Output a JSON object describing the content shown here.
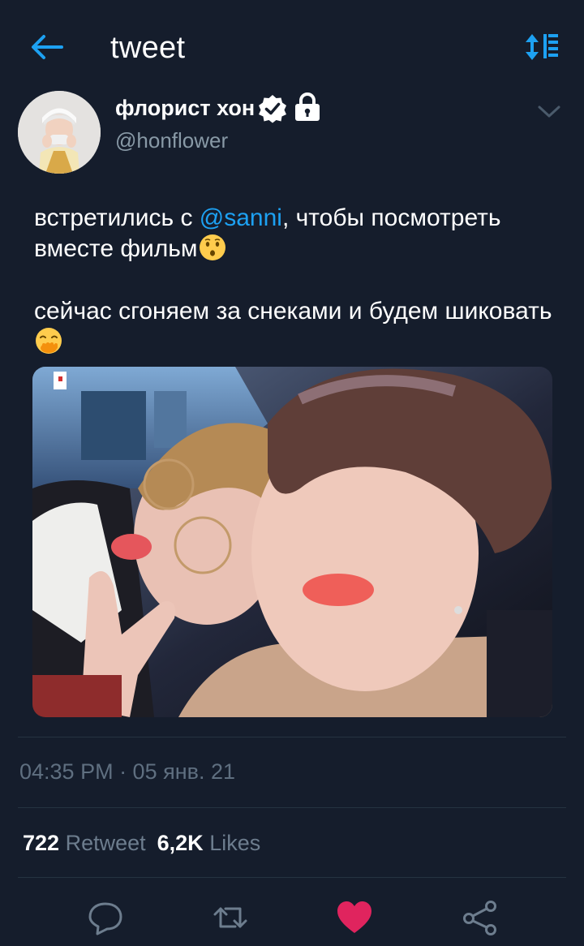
{
  "header": {
    "back_icon": "arrow-left-icon",
    "title": "tweet",
    "sort_icon": "sort-icon"
  },
  "author": {
    "name": "флорист хон",
    "handle": "@honflower",
    "verified_icon": "verified-badge-icon",
    "protected_icon": "lock-icon",
    "menu_icon": "chevron-down-icon"
  },
  "tweet": {
    "line1_before": "встретились с ",
    "mention": "@sanni",
    "line1_after": ", чтобы посмотреть вместе фильм",
    "emoji1": "kissing-face-icon",
    "line2": "сейчас сгоняем за снеками и будем шиковать",
    "emoji2": "hand-over-mouth-face-icon",
    "media": "photo"
  },
  "meta": {
    "timestamp": "04:35 PM · 05 янв. 21"
  },
  "stats": {
    "retweets_count": "722",
    "retweets_label": "Retweet",
    "likes_count": "6,2K",
    "likes_label": "Likes"
  },
  "actions": [
    {
      "name": "reply",
      "icon": "speech-bubble-icon"
    },
    {
      "name": "retweet",
      "icon": "retweet-icon"
    },
    {
      "name": "like",
      "icon": "heart-icon",
      "active": true
    },
    {
      "name": "share",
      "icon": "share-icon"
    }
  ],
  "colors": {
    "background": "#151d2c",
    "accent": "#1da1f2",
    "secondary_text": "#8899a6",
    "like_active": "#e0245e",
    "divider": "#253341"
  }
}
